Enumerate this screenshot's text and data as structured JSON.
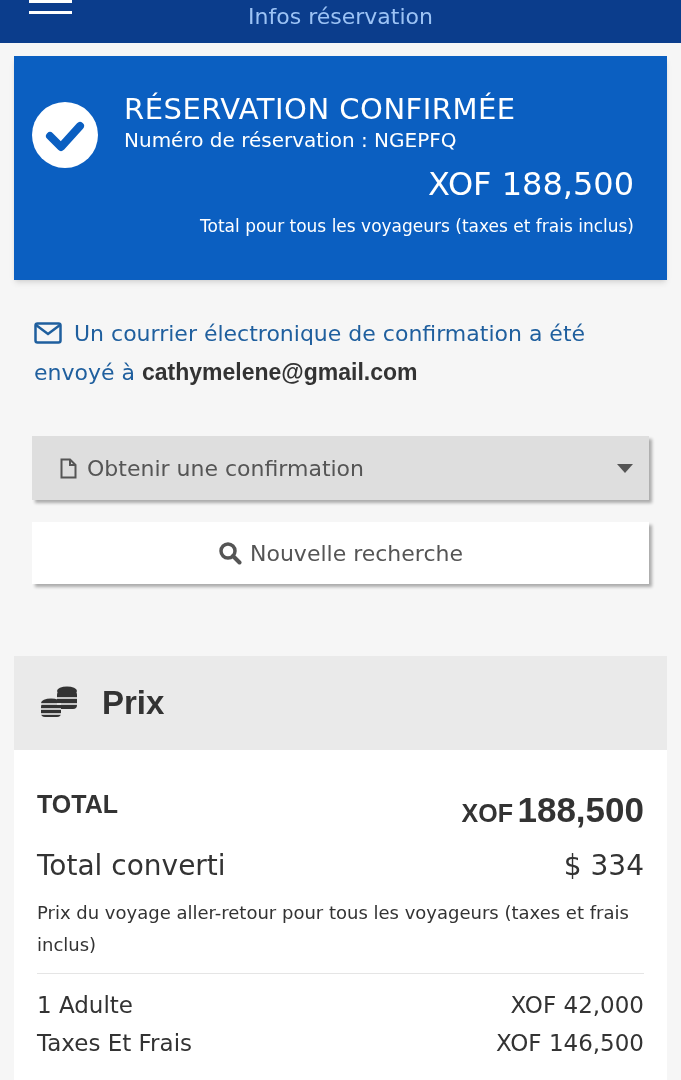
{
  "header": {
    "title": "Infos réservation"
  },
  "confirmation": {
    "title": "RÉSERVATION CONFIRMÉE",
    "reference_label": "Numéro de réservation :",
    "reference": "NGEPFQ",
    "amount": "XOF 188,500",
    "note": "Total pour tous les voyageurs (taxes et frais inclus)"
  },
  "email_notice": "Un courrier électronique de confirmation a été envoyé à  **cathymelene@gmail.com**",
  "actions": [
    {
      "kind": "dropdown",
      "label": "Obtenir une confirmation"
    },
    {
      "kind": "search",
      "label": "Nouvelle recherche"
    }
  ],
  "price": {
    "title": "Prix",
    "total_label": "TOTAL",
    "total_currency": "XOF",
    "total_amount": "188,500",
    "converted_label": "Total converti",
    "converted_amount": "$ 334",
    "note": "Prix du voyage aller-retour pour tous les voyageurs (taxes et frais inclus)",
    "lines": [
      {
        "label": "1 Adulte",
        "amount": "XOF 42,000"
      },
      {
        "label": "Taxes Et Frais",
        "amount": "XOF 146,500"
      }
    ]
  }
}
